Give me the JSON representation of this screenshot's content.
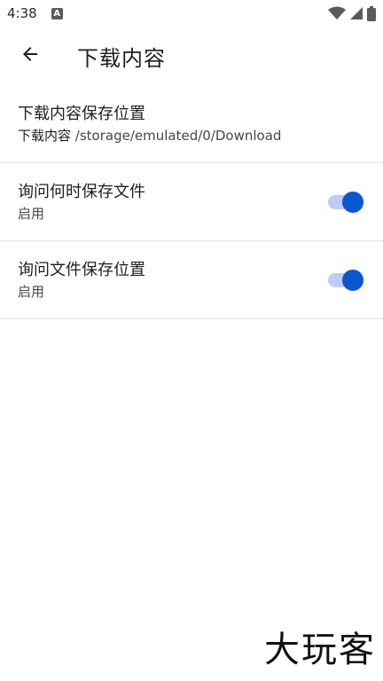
{
  "status_bar": {
    "time": "4:38",
    "notification_icon": "A"
  },
  "app_bar": {
    "title": "下载内容"
  },
  "settings": [
    {
      "title": "下载内容保存位置",
      "summary_bold": "下载内容",
      "summary_rest": " /storage/emulated/0/Download"
    },
    {
      "title": "询问何时保存文件",
      "summary": "启用",
      "toggle_on": true
    },
    {
      "title": "询问文件保存位置",
      "summary": "启用",
      "toggle_on": true
    }
  ],
  "colors": {
    "accent": "#0b57d0",
    "track": "#b9cdf6",
    "divider": "#e3e3e3"
  },
  "watermark": "大玩客"
}
